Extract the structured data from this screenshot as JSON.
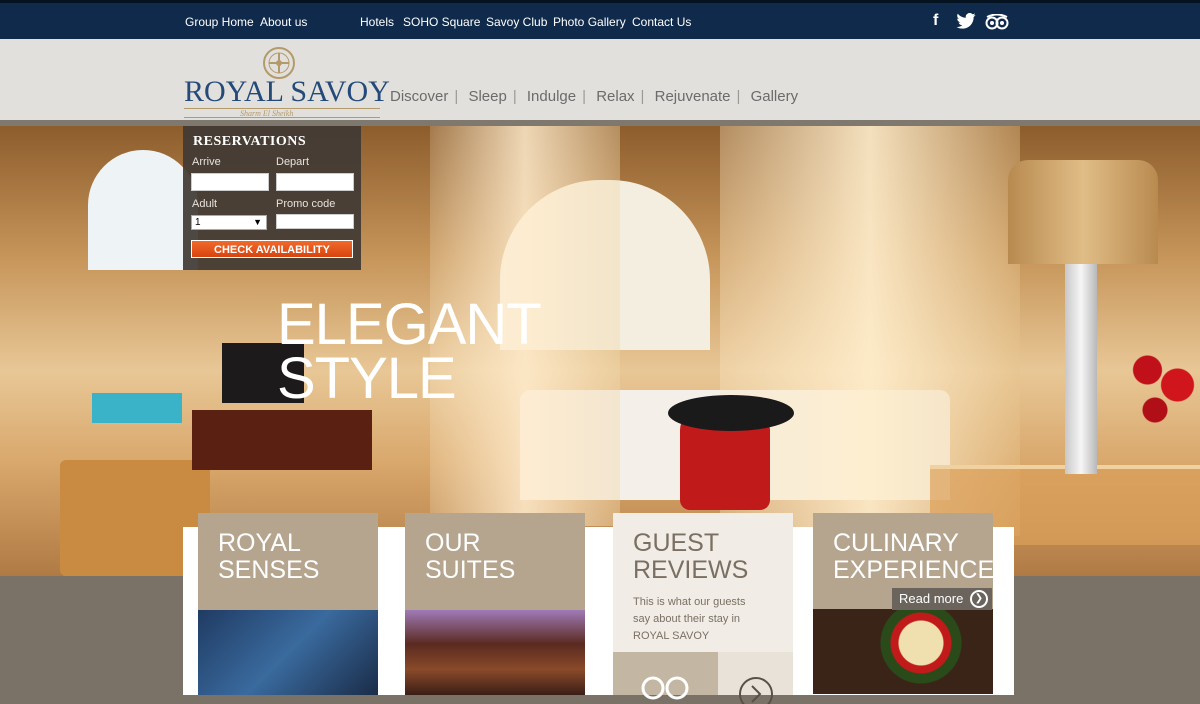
{
  "topnav": {
    "group_home": "Group Home",
    "about_us": "About us",
    "hotels": "Hotels",
    "soho_square": "SOHO Square",
    "savoy_club": "Savoy Club",
    "photo_gallery": "Photo Gallery",
    "contact_us": "Contact Us"
  },
  "social": {
    "facebook": "f",
    "twitter": "twitter-icon",
    "tripadvisor": "tripadvisor-icon"
  },
  "logo": {
    "name": "ROYAL SAVOY",
    "tagline": "Sharm El Sheikh"
  },
  "mainnav": [
    "Discover",
    "Sleep",
    "Indulge",
    "Relax",
    "Rejuvenate",
    "Gallery"
  ],
  "hero": {
    "line1": "ELEGANT",
    "line2": "STYLE"
  },
  "reservations": {
    "title": "RESERVATIONS",
    "arrive_label": "Arrive",
    "depart_label": "Depart",
    "adult_label": "Adult",
    "promo_label": "Promo code",
    "adult_value": "1",
    "button": "CHECK AVAILABILITY"
  },
  "cards": {
    "royal_senses": {
      "line1": "ROYAL",
      "line2": "SENSES"
    },
    "our_suites": {
      "line1": "OUR",
      "line2": "SUITES"
    },
    "guest_reviews": {
      "line1": "GUEST",
      "line2": "REVIEWS",
      "desc1": "This is what our guests",
      "desc2": "say about their stay in",
      "desc3": "ROYAL SAVOY"
    },
    "culinary": {
      "line1": "CULINARY",
      "line2": "EXPERIENCES",
      "read_more": "Read more"
    }
  }
}
